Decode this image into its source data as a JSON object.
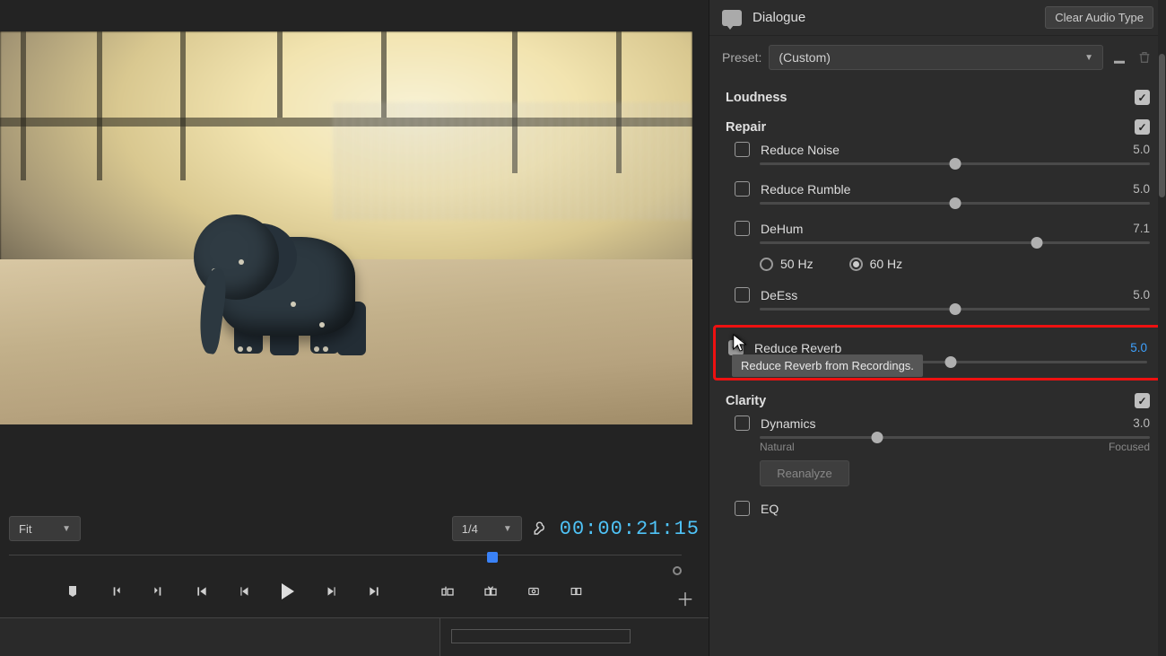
{
  "panel": {
    "title": "Dialogue",
    "clear_btn": "Clear Audio Type",
    "preset_label": "Preset:",
    "preset_value": "(Custom)"
  },
  "sections": {
    "loudness": {
      "title": "Loudness",
      "enabled": true
    },
    "repair": {
      "title": "Repair",
      "enabled": true,
      "reduce_noise": {
        "label": "Reduce Noise",
        "value": "5.0",
        "checked": false,
        "pos": 50
      },
      "reduce_rumble": {
        "label": "Reduce Rumble",
        "value": "5.0",
        "checked": false,
        "pos": 50
      },
      "dehum": {
        "label": "DeHum",
        "value": "7.1",
        "checked": false,
        "pos": 71,
        "hz50": "50 Hz",
        "hz60": "60 Hz",
        "hz_selected": "60"
      },
      "deess": {
        "label": "DeEss",
        "value": "5.0",
        "checked": false,
        "pos": 50
      },
      "reduce_reverb": {
        "label": "Reduce Reverb",
        "value": "5.0",
        "checked": true,
        "pos": 50,
        "tooltip": "Reduce Reverb from Recordings."
      }
    },
    "clarity": {
      "title": "Clarity",
      "enabled": true,
      "dynamics": {
        "label": "Dynamics",
        "value": "3.0",
        "checked": false,
        "pos": 30,
        "min_label": "Natural",
        "max_label": "Focused"
      },
      "reanalyze": "Reanalyze",
      "eq": {
        "label": "EQ",
        "checked": false
      }
    }
  },
  "viewer": {
    "fit": "Fit",
    "zoom": "1/4",
    "timecode": "00:00:21:15"
  }
}
